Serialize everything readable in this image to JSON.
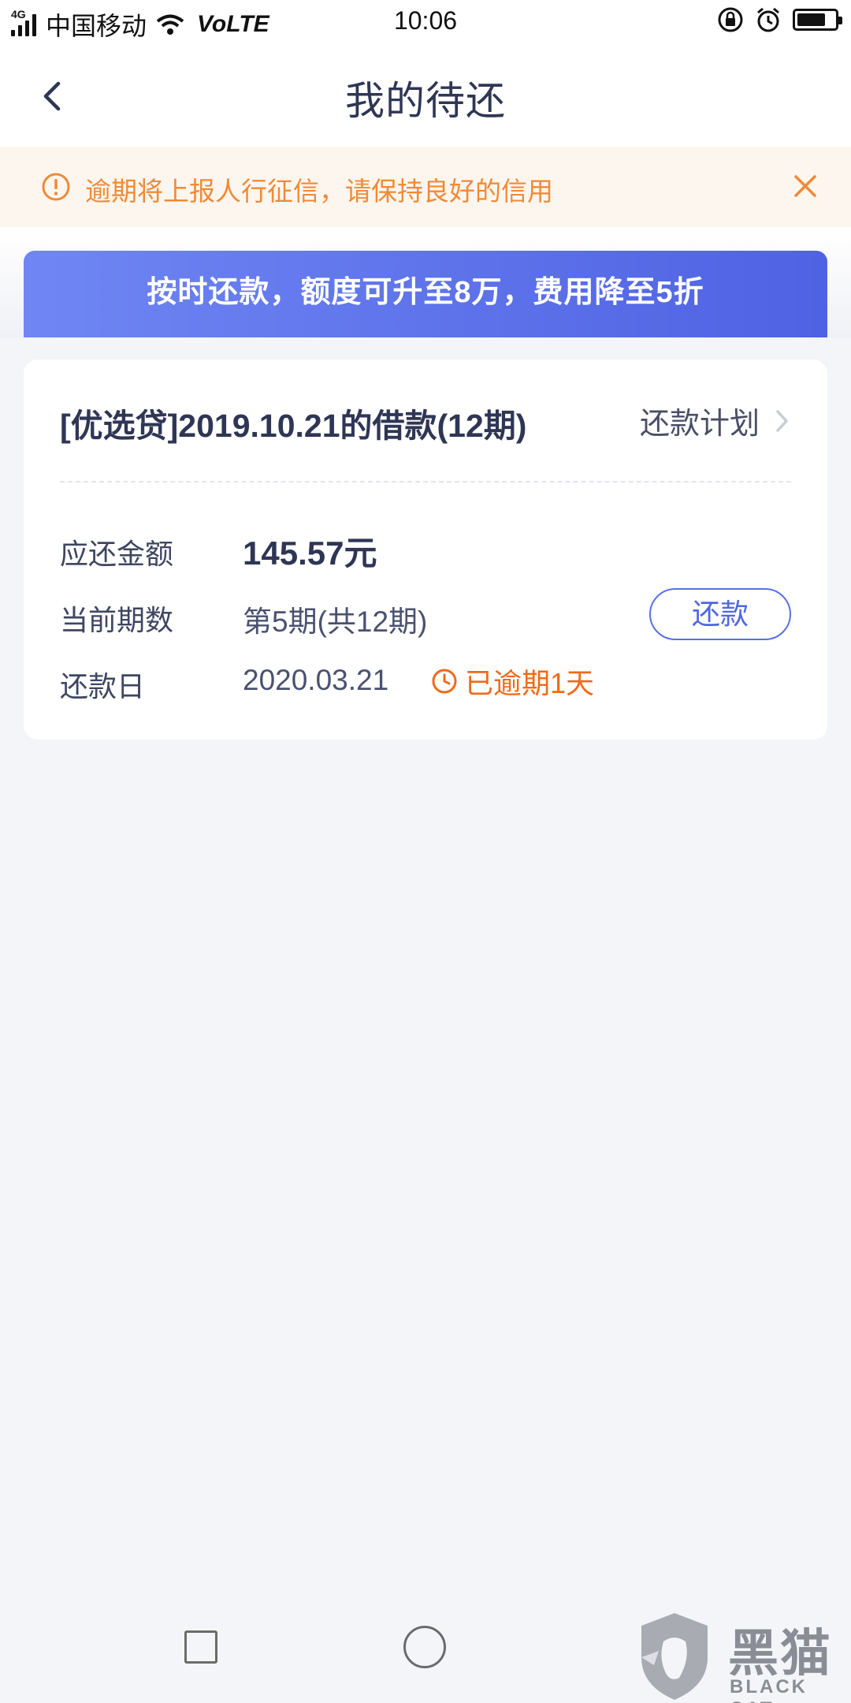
{
  "status_bar": {
    "network": "4G",
    "carrier": "中国移动",
    "volte": "VoLTE",
    "time": "10:06",
    "battery_level": 0.75,
    "icons": [
      "signal-icon",
      "wifi-icon",
      "rotation-lock-icon",
      "alarm-icon",
      "battery-icon"
    ]
  },
  "header": {
    "title": "我的待还",
    "back_icon": "chevron-left-icon"
  },
  "notice": {
    "text": "逾期将上报人行征信，请保持良好的信用",
    "icon": "warning-circle-icon",
    "close_icon": "close-icon",
    "color": "#f08a37",
    "background": "#fdf6ee"
  },
  "promo": {
    "text": "按时还款，额度可升至8万，费用降至5折",
    "gradient": [
      "#6f86f3",
      "#4f62e3"
    ]
  },
  "loan": {
    "title": "[优选贷]2019.10.21的借款(12期)",
    "plan_label": "还款计划",
    "amount_label": "应还金额",
    "amount_value": "145.57元",
    "period_label": "当前期数",
    "period_value": "第5期(共12期)",
    "repay_button": "还款",
    "due_label": "还款日",
    "due_date": "2020.03.21",
    "overdue_text": "已逾期1天",
    "overdue_color": "#ef6a1a",
    "accent": "#4f66e4"
  },
  "nav": {
    "items": [
      "recent-apps-button",
      "home-button"
    ]
  },
  "watermark": {
    "cn": "黑猫",
    "en": "BLACK CAT"
  }
}
